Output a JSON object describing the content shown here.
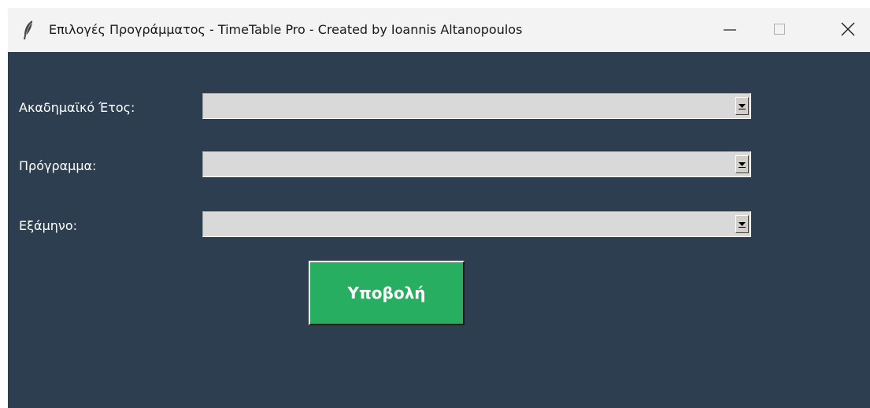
{
  "window": {
    "title": "Επιλογές Προγράμματος - TimeTable Pro - Created by Ioannis Altanopoulos",
    "controls": {
      "minimize_icon": "minimize-icon",
      "maximize_icon": "maximize-icon",
      "close_icon": "close-icon"
    }
  },
  "form": {
    "fields": [
      {
        "label": "Ακαδημαϊκό Έτος:",
        "value": ""
      },
      {
        "label": "Πρόγραμμα:",
        "value": ""
      },
      {
        "label": "Εξάμηνο:",
        "value": ""
      }
    ],
    "submit_label": "Υποβολή"
  },
  "colors": {
    "background": "#2c3e50",
    "submit_button": "#27ae60",
    "combo_background": "#d9d9d9",
    "titlebar": "#f3f3f3"
  }
}
